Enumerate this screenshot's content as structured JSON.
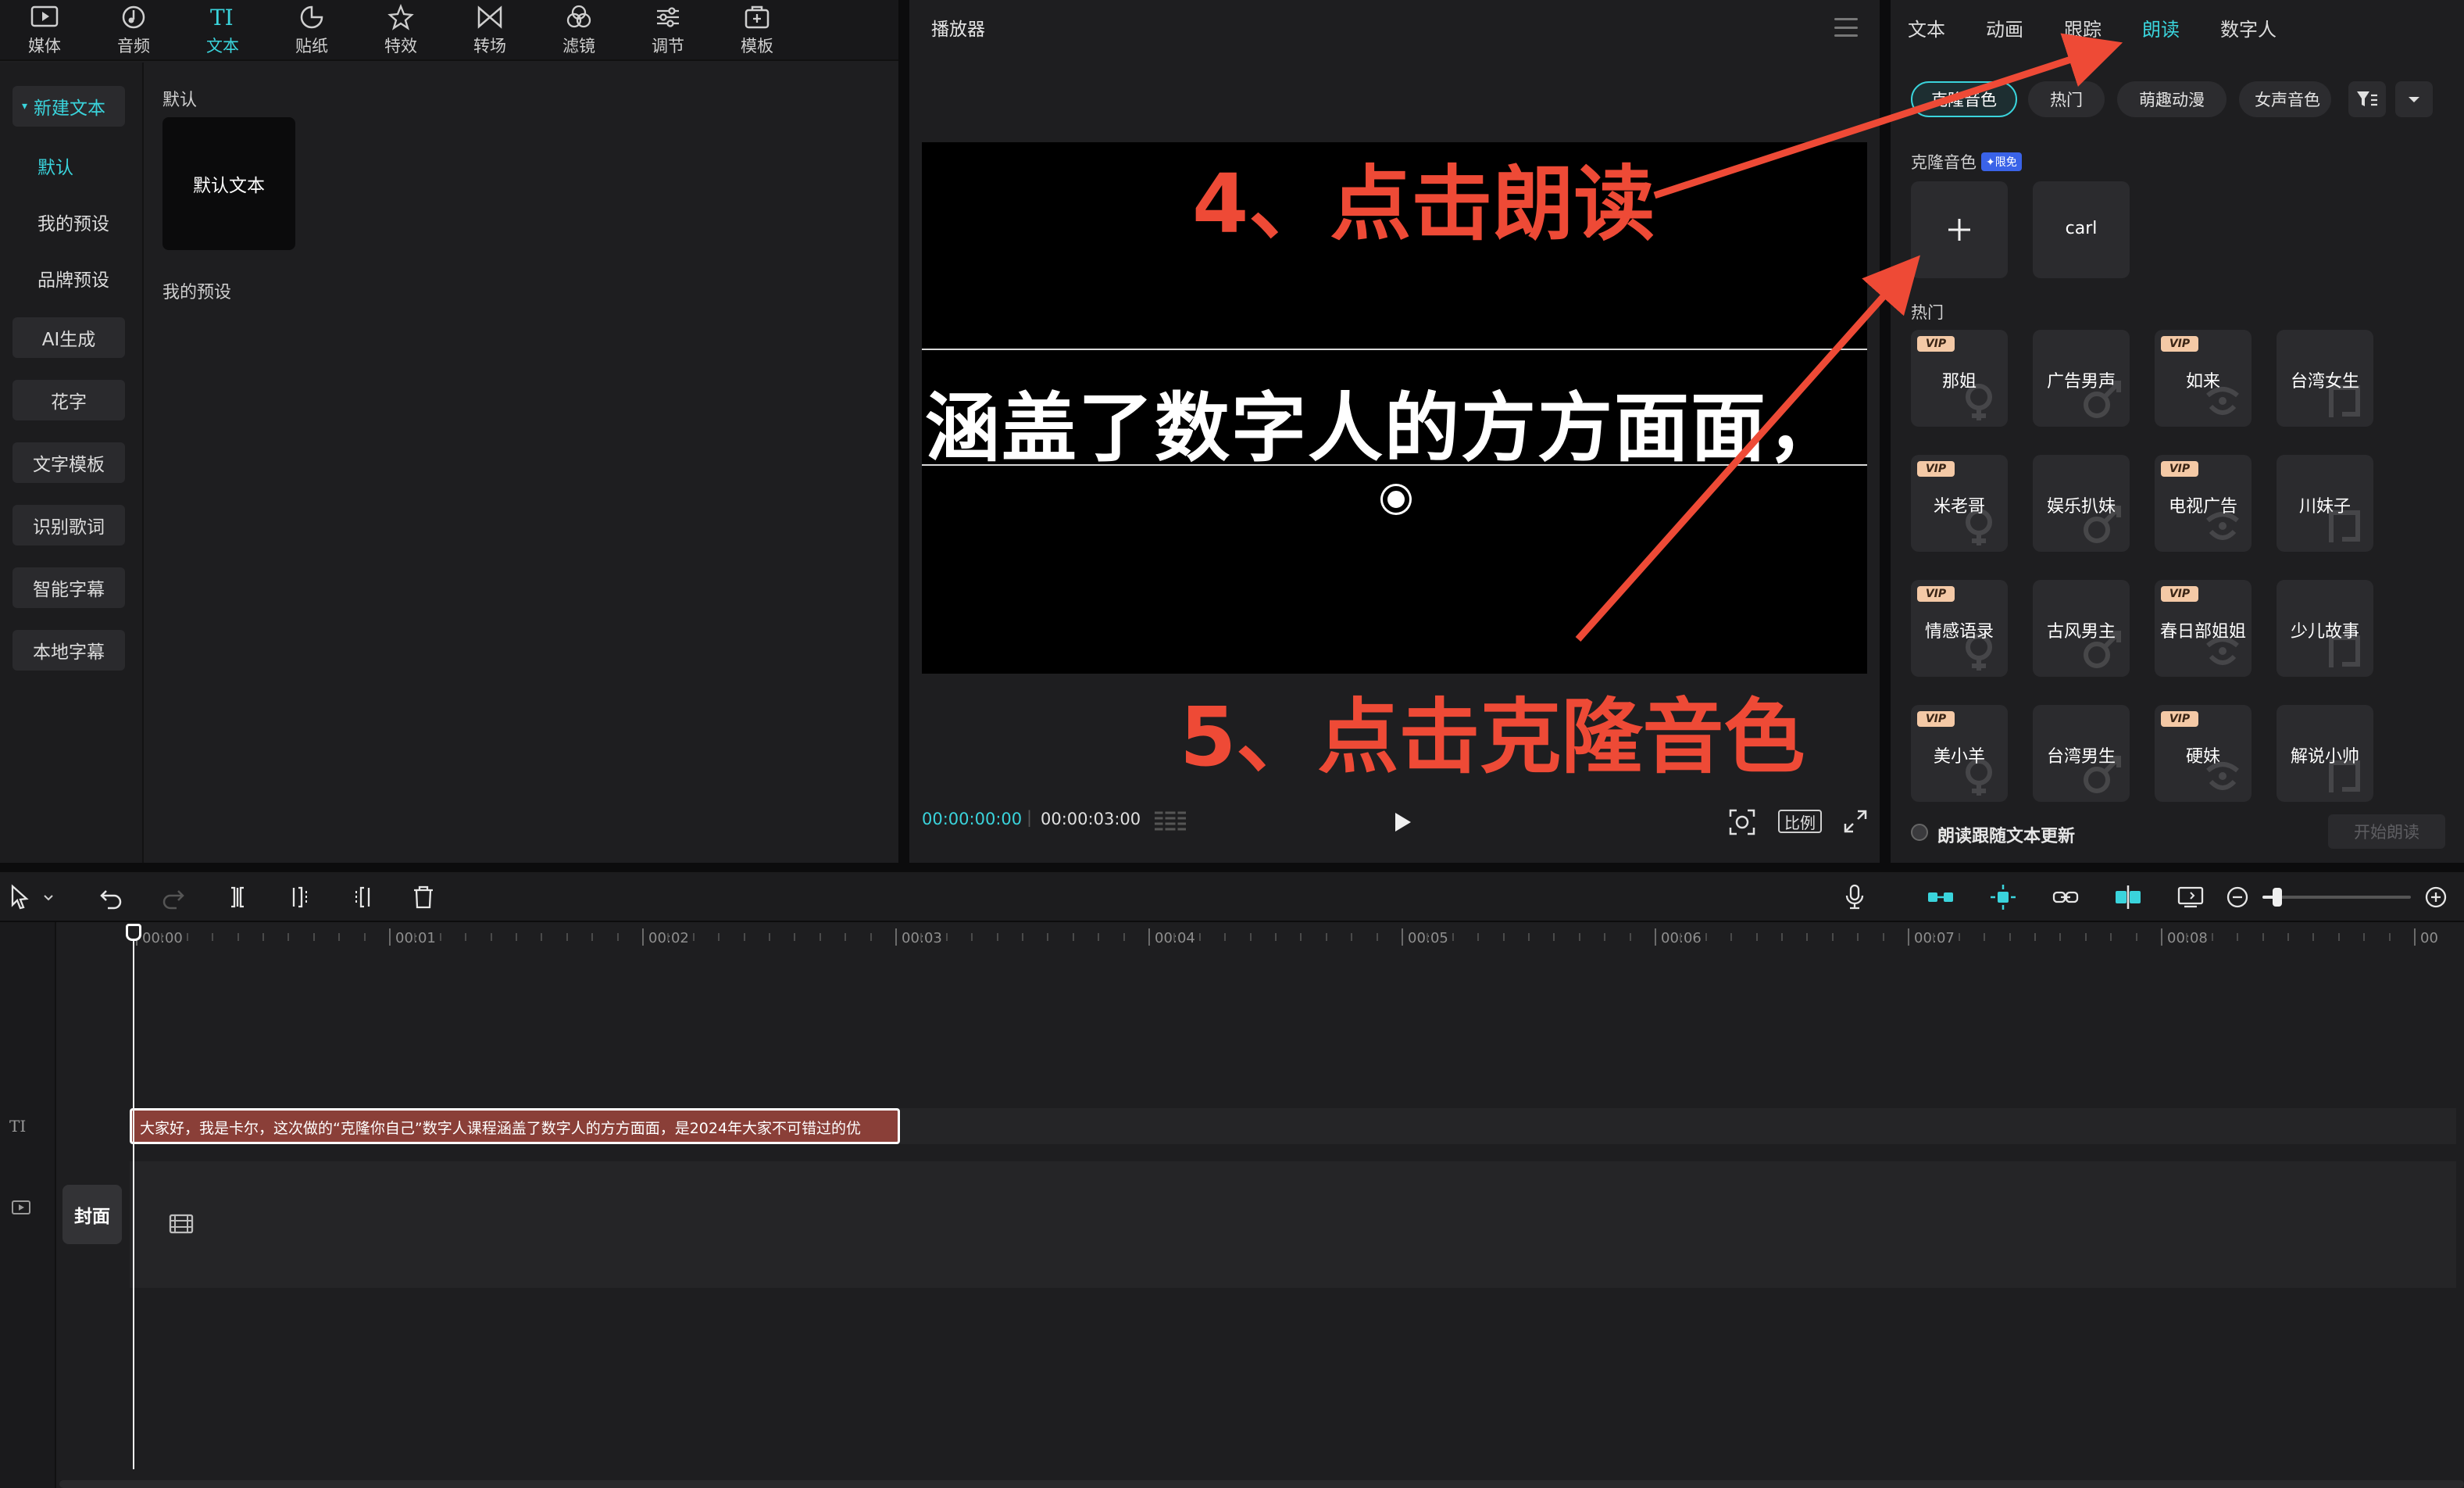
{
  "toolbar_tabs": [
    {
      "label": "媒体",
      "icon": "media-icon"
    },
    {
      "label": "音频",
      "icon": "audio-icon"
    },
    {
      "label": "文本",
      "icon": "text-icon",
      "active": true
    },
    {
      "label": "贴纸",
      "icon": "sticker-icon"
    },
    {
      "label": "特效",
      "icon": "effects-icon"
    },
    {
      "label": "转场",
      "icon": "transition-icon"
    },
    {
      "label": "滤镜",
      "icon": "filter-icon"
    },
    {
      "label": "调节",
      "icon": "adjust-icon"
    },
    {
      "label": "模板",
      "icon": "template-icon"
    }
  ],
  "sidebar": {
    "group_label": "新建文本",
    "sub_items": [
      "默认",
      "我的预设",
      "品牌预设"
    ],
    "buttons": [
      "AI生成",
      "花字",
      "文字模板",
      "识别歌词",
      "智能字幕",
      "本地字幕"
    ]
  },
  "library": {
    "section_default": "默认",
    "default_card": "默认文本",
    "section_presets": "我的预设"
  },
  "player": {
    "title": "播放器",
    "caption": "涵盖了数字人的方方面面，",
    "time_current": "00:00:00:00",
    "time_total": "00:00:03:00",
    "ratio_label": "比例"
  },
  "right_panel": {
    "tabs": [
      "文本",
      "动画",
      "跟踪",
      "朗读",
      "数字人"
    ],
    "active_tab": "朗读",
    "filters": [
      "克隆音色",
      "热门",
      "萌趣动漫",
      "女声音色"
    ],
    "clone_section": "克隆音色",
    "limited_badge": "限免",
    "clone_voice": "carl",
    "hot_section": "热门",
    "vip_label": "VIP",
    "voices": [
      {
        "name": "那姐",
        "vip": true
      },
      {
        "name": "广告男声",
        "vip": false
      },
      {
        "name": "如来",
        "vip": true
      },
      {
        "name": "台湾女生",
        "vip": false
      },
      {
        "name": "米老哥",
        "vip": true
      },
      {
        "name": "娱乐扒妹",
        "vip": false
      },
      {
        "name": "电视广告",
        "vip": true
      },
      {
        "name": "川妹子",
        "vip": false
      },
      {
        "name": "情感语录",
        "vip": true
      },
      {
        "name": "古风男主",
        "vip": false
      },
      {
        "name": "春日部姐姐",
        "vip": true
      },
      {
        "name": "少儿故事",
        "vip": false
      },
      {
        "name": "美小羊",
        "vip": true
      },
      {
        "name": "台湾男生",
        "vip": false
      },
      {
        "name": "硬妹",
        "vip": true
      },
      {
        "name": "解说小帅",
        "vip": false
      }
    ],
    "follow_label": "朗读跟随文本更新",
    "start_button": "开始朗读"
  },
  "timeline": {
    "ruler_labels": [
      "00:00",
      "00:01",
      "00:02",
      "00:03",
      "00:04",
      "00:05",
      "00:06",
      "00:07",
      "00:08",
      "00"
    ],
    "text_clip": "大家好，我是卡尔，这次做的“克隆你自己”数字人课程涵盖了数字人的方方面面，是2024年大家不可错过的优",
    "cover_label": "封面",
    "zoom_level": 0.1
  },
  "annotations": {
    "step4": "4、点击朗读",
    "step5": "5、点击克隆音色"
  },
  "colors": {
    "accent": "#3ad4dc",
    "annotation": "#ee4a36",
    "clip": "#8a3f38",
    "vip": "#f4c9a6",
    "limited_badge": "#3a63e8"
  }
}
